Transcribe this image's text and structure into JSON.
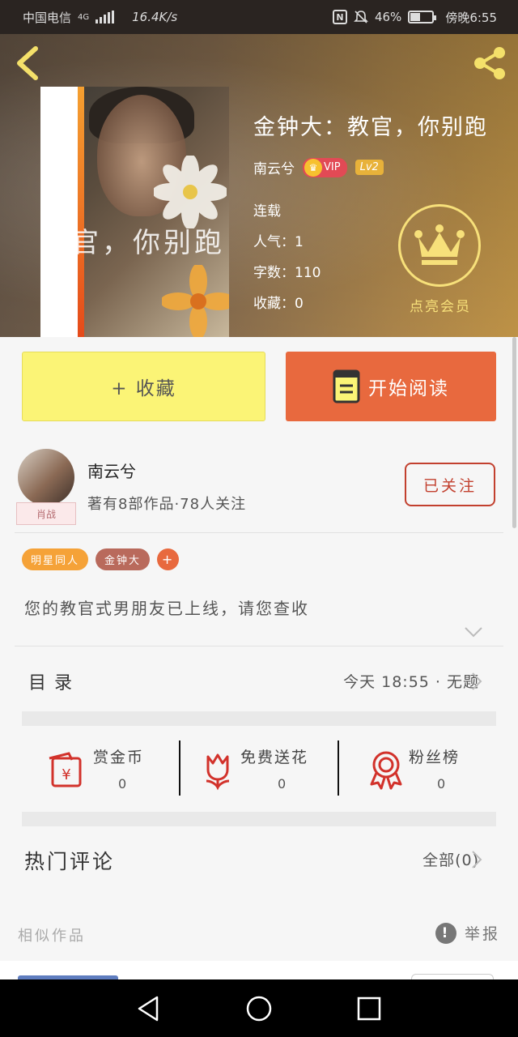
{
  "status_bar": {
    "carrier": "中国电信",
    "network": "4G",
    "speed": "16.4K/s",
    "nfc": "N",
    "battery": "46%",
    "time": "傍晚6:55"
  },
  "book": {
    "title": "金钟大：教官，你别跑",
    "cover_text": "教官，你别跑",
    "author": "南云兮",
    "vip_label": "VIP",
    "level_label": "Lv2",
    "status": "连载",
    "popularity": "人气：1",
    "word_count": "字数：110",
    "collections": "收藏：0"
  },
  "member": {
    "label": "点亮会员"
  },
  "actions": {
    "collect_label": "+ 收藏",
    "read_label": "开始阅读"
  },
  "author_card": {
    "name": "南云兮",
    "stats": "著有8部作品·78人关注",
    "avatar_tag": "肖战",
    "follow_label": "已关注"
  },
  "tags": [
    {
      "label": "明星同人",
      "color": "#f5a238"
    },
    {
      "label": "金钟大",
      "color": "#b96a5c"
    },
    {
      "label": "+",
      "color": "#e8693e"
    }
  ],
  "intro": "您的教官式男朋友已上线，请您查收",
  "toc": {
    "label": "目录",
    "latest": "今天 18:55 · 无题"
  },
  "stats": [
    {
      "label": "赏金币",
      "value": "0",
      "icon": "red-envelope-icon"
    },
    {
      "label": "免费送花",
      "value": "0",
      "icon": "flower-icon"
    },
    {
      "label": "粉丝榜",
      "value": "0",
      "icon": "award-ribbon-icon"
    }
  ],
  "comments": {
    "title": "热门评论",
    "all_label": "全部(0)"
  },
  "similar": {
    "title": "相似作品",
    "report_label": "举报"
  },
  "colors": {
    "accent_orange": "#e8693e",
    "collect_yellow": "#fbf476",
    "follow_red": "#c2402e",
    "member_gold": "#f7e07a"
  }
}
